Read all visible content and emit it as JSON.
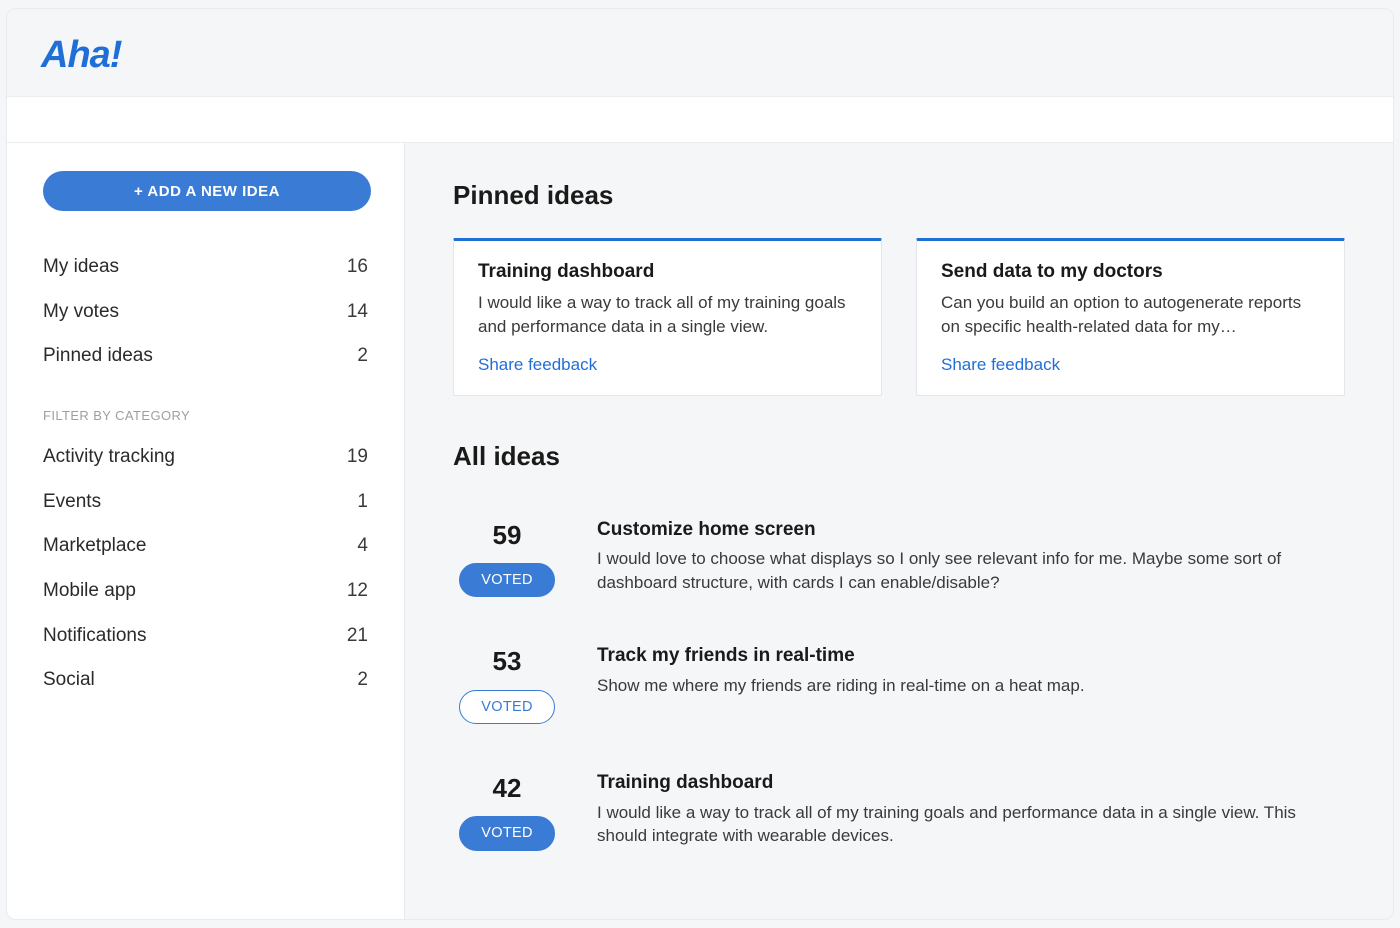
{
  "app": {
    "logo_text": "Aha!"
  },
  "sidebar": {
    "add_button_label": "+ ADD A NEW IDEA",
    "nav": [
      {
        "label": "My ideas",
        "count": "16"
      },
      {
        "label": "My votes",
        "count": "14"
      },
      {
        "label": "Pinned ideas",
        "count": "2"
      }
    ],
    "filter_heading": "FILTER BY CATEGORY",
    "categories": [
      {
        "label": "Activity tracking",
        "count": "19"
      },
      {
        "label": "Events",
        "count": "1"
      },
      {
        "label": "Marketplace",
        "count": "4"
      },
      {
        "label": "Mobile app",
        "count": "12"
      },
      {
        "label": "Notifications",
        "count": "21"
      },
      {
        "label": "Social",
        "count": "2"
      }
    ]
  },
  "main": {
    "pinned_title": "Pinned ideas",
    "pinned": [
      {
        "title": "Training dashboard",
        "body": "I would like a way to track all of my training goals and performance data in a single view.",
        "link_label": "Share feedback"
      },
      {
        "title": "Send data to my doctors",
        "body": "Can you build an option to autogenerate reports on specific health-related data for my…",
        "link_label": "Share feedback"
      }
    ],
    "all_title": "All ideas",
    "ideas": [
      {
        "votes": "59",
        "voted_label": "VOTED",
        "voted_style": "filled",
        "title": "Customize home screen",
        "body": "I would love to choose what displays so I only see relevant info for me. Maybe some sort of dashboard structure, with cards I can enable/disable?"
      },
      {
        "votes": "53",
        "voted_label": "VOTED",
        "voted_style": "outline",
        "title": "Track my friends in real-time",
        "body": "Show me where my friends are riding in real-time on a heat map."
      },
      {
        "votes": "42",
        "voted_label": "VOTED",
        "voted_style": "filled",
        "title": "Training dashboard",
        "body": "I would like a way to track all of my training goals and performance data in a single view. This should integrate with wearable devices."
      }
    ]
  }
}
